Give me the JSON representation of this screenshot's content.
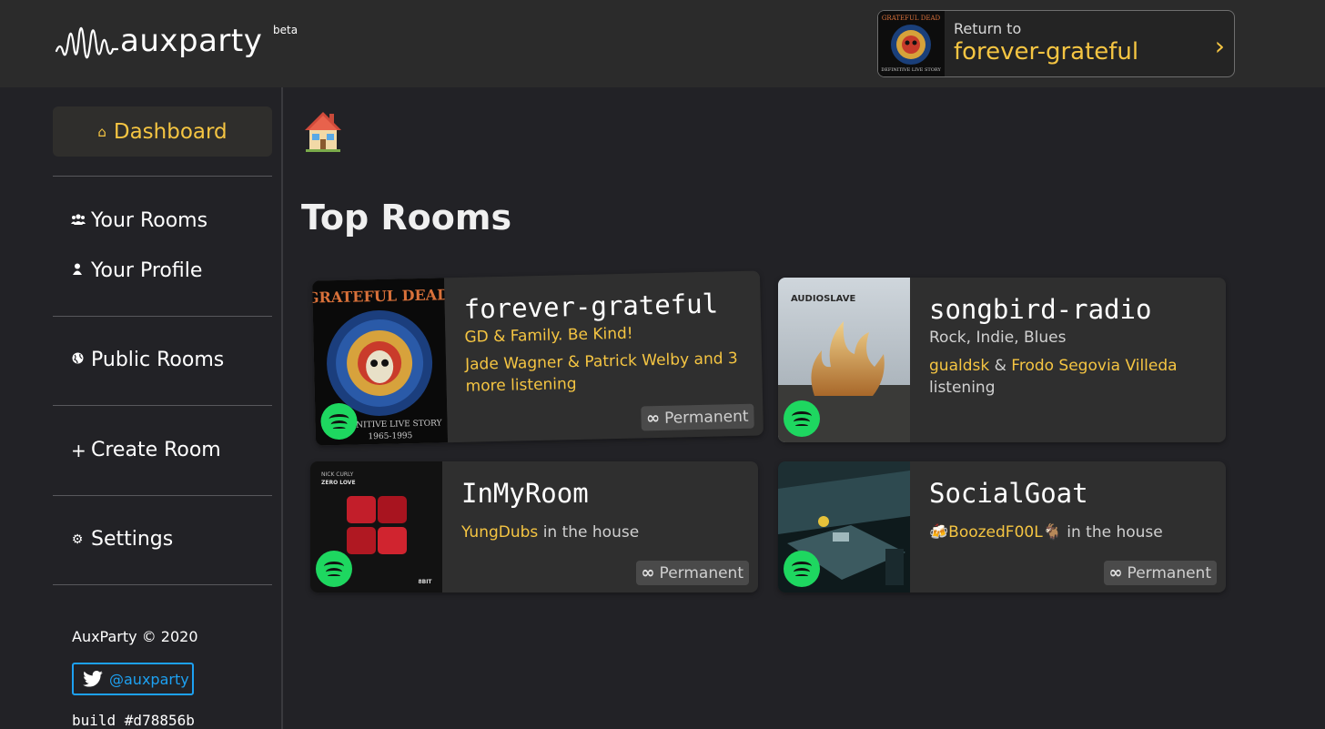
{
  "brand": {
    "name": "auxparty",
    "badge": "beta"
  },
  "return_to": {
    "label": "Return to",
    "room": "forever-grateful",
    "chevron": "›"
  },
  "sidebar": {
    "dashboard": {
      "icon": "home-icon",
      "label": "Dashboard"
    },
    "items": [
      {
        "icon": "users-icon",
        "label": "Your Rooms"
      },
      {
        "icon": "user-icon",
        "label": "Your Profile"
      },
      {
        "icon": "globe-icon",
        "label": "Public Rooms"
      },
      {
        "icon": "plus-icon",
        "label": "Create Room"
      },
      {
        "icon": "gear-icon",
        "label": "Settings"
      }
    ],
    "copyright": "AuxParty © 2020",
    "twitter_handle": "@auxparty",
    "build": "build #d78856b"
  },
  "main": {
    "header_icon": "house-emoji-icon",
    "title": "Top Rooms",
    "rooms": [
      {
        "name": "forever-grateful",
        "tagline": "GD & Family. Be Kind!",
        "listeners": [
          "Jade Wagner",
          "&",
          "Patrick Welby",
          "and 3 more listening"
        ],
        "badge": "Permanent",
        "album_text": [
          "GRATEFUL DEAD",
          "DEFINITIVE LIVE STORY",
          "1965-1995"
        ],
        "platform_icon": "spotify-icon"
      },
      {
        "name": "songbird-radio",
        "tagline": "Rock, Indie, Blues",
        "listeners": [
          "gualdsk",
          "&",
          "Frodo Segovia Villeda",
          "listening"
        ],
        "album_text": [
          "AUDIOSLAVE"
        ],
        "platform_icon": "spotify-icon"
      },
      {
        "name": "InMyRoom",
        "listeners": [
          "YungDubs",
          "in the house"
        ],
        "badge": "Permanent",
        "album_text": [
          "NICK CURLY",
          "ZERO LOVE",
          "8BIT"
        ],
        "platform_icon": "spotify-icon"
      },
      {
        "name": "SocialGoat",
        "listeners": [
          "🍻BoozedF00L🐐",
          "in the house"
        ],
        "badge": "Permanent",
        "platform_icon": "spotify-icon"
      }
    ]
  },
  "colors": {
    "accent": "#f5c542",
    "background": "#222226",
    "topbar": "#2b2b2b",
    "card": "#2f2f2f",
    "spotify": "#1ed760",
    "twitter": "#1da1f2"
  }
}
